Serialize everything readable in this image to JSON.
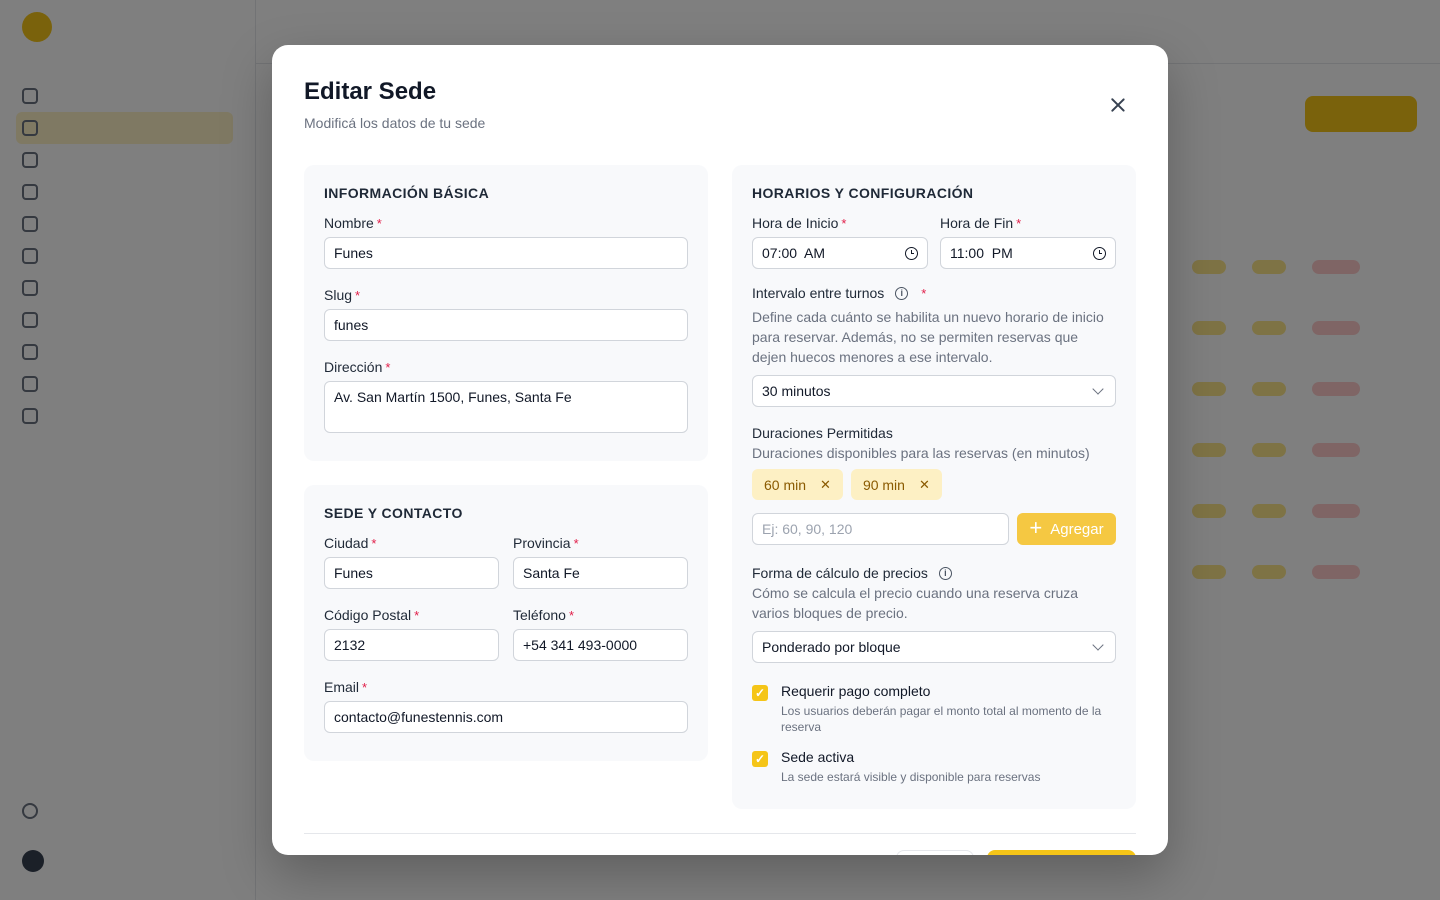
{
  "modal": {
    "title": "Editar Sede",
    "subtitle": "Modificá los datos de tu sede"
  },
  "basic": {
    "heading": "INFORMACIÓN BÁSICA",
    "nombre_label": "Nombre",
    "nombre_value": "Funes",
    "slug_label": "Slug",
    "slug_value": "funes",
    "direccion_label": "Dirección",
    "direccion_value": "Av. San Martín 1500, Funes, Santa Fe"
  },
  "contact": {
    "heading": "SEDE Y CONTACTO",
    "ciudad_label": "Ciudad",
    "ciudad_value": "Funes",
    "provincia_label": "Provincia",
    "provincia_value": "Santa Fe",
    "cp_label": "Código Postal",
    "cp_value": "2132",
    "telefono_label": "Teléfono",
    "telefono_value": "+54 341 493-0000",
    "email_label": "Email",
    "email_value": "contacto@funestennis.com"
  },
  "schedule": {
    "heading": "HORARIOS Y CONFIGURACIÓN",
    "inicio_label": "Hora de Inicio",
    "inicio_value": "07:00  AM",
    "fin_label": "Hora de Fin",
    "fin_value": "11:00  PM",
    "intervalo_label": "Intervalo entre turnos",
    "intervalo_help": "Define cada cuánto se habilita un nuevo horario de inicio para reservar. Además, no se permiten reservas que dejen huecos menores a ese intervalo.",
    "intervalo_value": "30 minutos",
    "duraciones_label": "Duraciones Permitidas",
    "duraciones_help": "Duraciones disponibles para las reservas (en minutos)",
    "chips": [
      "60 min",
      "90 min"
    ],
    "duracion_placeholder": "Ej: 60, 90, 120",
    "agregar_label": "Agregar",
    "precio_label": "Forma de cálculo de precios",
    "precio_help": "Cómo se calcula el precio cuando una reserva cruza varios bloques de precio.",
    "precio_value": "Ponderado por bloque",
    "pago_title": "Requerir pago completo",
    "pago_desc": "Los usuarios deberán pagar el monto total al momento de la reserva",
    "activa_title": "Sede activa",
    "activa_desc": "La sede estará visible y disponible para reservas"
  },
  "required_mark": "*",
  "colors": {
    "accent": "#f5c518",
    "chip_bg": "#fdf0c4",
    "required": "#e11d48"
  }
}
